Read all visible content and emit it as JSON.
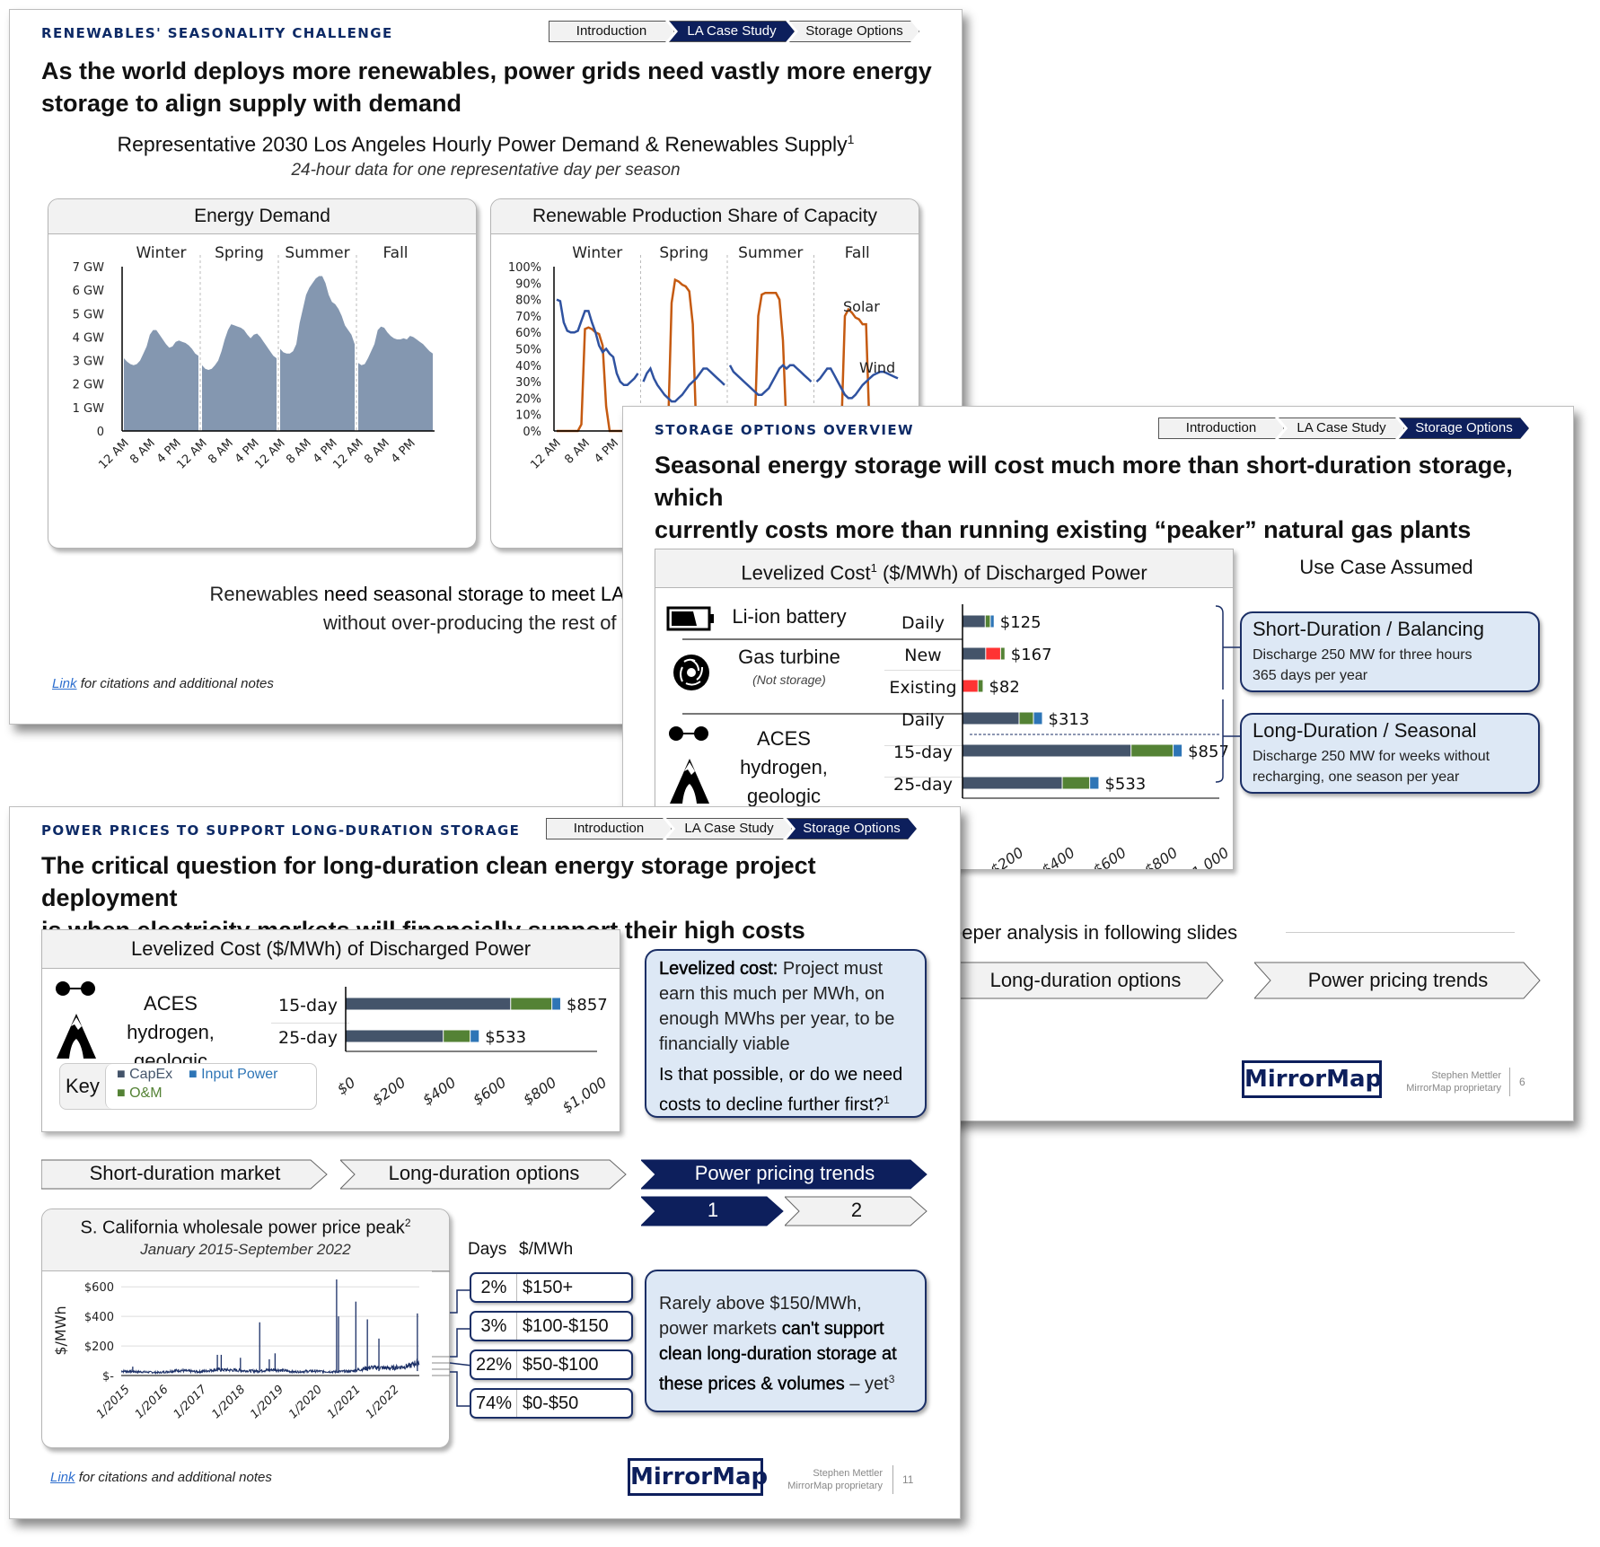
{
  "slide1": {
    "kicker": "RENEWABLES' SEASONALITY CHALLENGE",
    "breadcrumbs": [
      {
        "label": "Introduction",
        "active": false
      },
      {
        "label": "LA Case Study",
        "active": true
      },
      {
        "label": "Storage Options",
        "active": false
      }
    ],
    "headline_line1": "As the world deploys more renewables, power grids need vastly more energy",
    "headline_line2": "storage to align supply with demand",
    "chart_title": "Representative 2030 Los Angeles Hourly Power Demand & Renewables Supply",
    "chart_title_sup": "1",
    "chart_subtitle": "24-hour data for one representative day per season",
    "conclusion_line1_plain": "Renewables ",
    "conclusion_line1_bold": "need seasonal storage to meet LA's",
    "conclusion_line2": "without over-producing the rest of th",
    "footer_link": "Link",
    "footer_text": " for citations and additional notes"
  },
  "slide2": {
    "kicker": "STORAGE OPTIONS OVERVIEW",
    "breadcrumbs": [
      {
        "label": "Introduction",
        "active": false
      },
      {
        "label": "LA Case Study",
        "active": false
      },
      {
        "label": "Storage Options",
        "active": true
      }
    ],
    "headline_line1": "Seasonal energy storage will cost much more than short-duration storage, which",
    "headline_line2": "currently costs more than running existing “peaker” natural gas plants",
    "cost_box_title": "Levelized Cost",
    "cost_box_title_sup": "1",
    "cost_box_title_rest": " ($/MWh) of Discharged Power",
    "technologies": [
      {
        "name": "Li-ion battery",
        "sub": "",
        "icon": "battery-icon"
      },
      {
        "name": "Gas turbine",
        "sub": "(Not storage)",
        "icon": "turbine-icon"
      },
      {
        "name_line1": "ACES hydrogen,",
        "name_line2": "geologic storage",
        "icon": "hydrogen-geologic-icon"
      }
    ],
    "use_case_header": "Use Case Assumed",
    "use_cases": [
      {
        "title": "Short-Duration / Balancing",
        "line1": "Discharge 250 MW for three hours",
        "line2": "365 days per year"
      },
      {
        "title": "Long-Duration / Seasonal",
        "line1": "Discharge 250 MW for weeks without",
        "line2": "recharging, one season per year"
      }
    ],
    "deeper_label": "eeper analysis in following slides",
    "chevrons": [
      "Long-duration options",
      "Power pricing trends"
    ],
    "logo": "MirrorMap",
    "author": "Stephen Mettler",
    "proprietary": "MirrorMap proprietary",
    "page": "6"
  },
  "slide3": {
    "kicker": "POWER PRICES TO SUPPORT LONG-DURATION STORAGE",
    "breadcrumbs": [
      {
        "label": "Introduction",
        "active": false
      },
      {
        "label": "LA Case Study",
        "active": false
      },
      {
        "label": "Storage Options",
        "active": true
      }
    ],
    "headline_line1": "The critical question for long-duration clean energy storage project deployment",
    "headline_line2": "is when electricity markets will financially support their high costs",
    "cost_box_title": "Levelized Cost ($/MWh) of Discharged Power",
    "tech_line1": "ACES hydrogen,",
    "tech_line2": "geologic storage",
    "key_label": "Key",
    "key_items": [
      {
        "label": "CapEx",
        "color": "#44546a"
      },
      {
        "label": "Input Power",
        "color": "#2e75b6"
      },
      {
        "label": "O&M",
        "color": "#548235"
      }
    ],
    "callout_bold": "Levelized cost:",
    "callout_text": " Project must earn this much per MWh, on enough MWhs per year, to be financially viable",
    "callout_question": "Is that possible, or do we need costs to decline further first?",
    "callout_question_sup": "1",
    "chevrons": [
      {
        "label": "Short-duration market",
        "active": false
      },
      {
        "label": "Long-duration options",
        "active": false
      },
      {
        "label": "Power pricing trends",
        "active": true
      }
    ],
    "sub_chevrons": [
      {
        "label": "1",
        "active": true
      },
      {
        "label": "2",
        "active": false
      }
    ],
    "price_chart_title": "S. California wholesale power price peak",
    "price_chart_title_sup": "2",
    "price_chart_subtitle": "January 2015-September 2022",
    "days_header": "Days",
    "mwh_header": "$/MWh",
    "price_buckets": [
      {
        "pct": "2%",
        "range": "$150+"
      },
      {
        "pct": "3%",
        "range": "$100-$150"
      },
      {
        "pct": "22%",
        "range": "$50-$100"
      },
      {
        "pct": "74%",
        "range": "$0-$50"
      }
    ],
    "conclusion_plain1": "Rarely above $150/MWh, power markets ",
    "conclusion_bold": "can't support clean long-duration storage at these prices & volumes",
    "conclusion_plain2": " – yet",
    "conclusion_sup": "3",
    "footer_link": "Link",
    "footer_text": " for citations and additional notes",
    "logo": "MirrorMap",
    "author": "Stephen Mettler",
    "proprietary": "MirrorMap proprietary",
    "page": "11"
  },
  "colors": {
    "navy": "#0d1f5c",
    "capex": "#44546a",
    "om": "#548235",
    "input_power": "#2e75b6",
    "fuel": "#ff3333",
    "solar": "#c55a11",
    "wind": "#2f52a0",
    "demand_fill": "#8497b0"
  },
  "chart_data": [
    {
      "id": "energy-demand",
      "type": "area",
      "title": "Energy Demand",
      "seasons": [
        "Winter",
        "Spring",
        "Summer",
        "Fall"
      ],
      "ylabel": "",
      "yticks": [
        "0",
        "1 GW",
        "2 GW",
        "3 GW",
        "4 GW",
        "5 GW",
        "6 GW",
        "7 GW"
      ],
      "ylim": [
        0,
        7
      ],
      "xticks": [
        "12 AM",
        "8 AM",
        "4 PM",
        "12 AM",
        "8 AM",
        "4 PM",
        "12 AM",
        "8 AM",
        "4 PM",
        "12 AM",
        "8 AM",
        "4 PM"
      ],
      "series": [
        {
          "name": "Winter",
          "values": [
            3.1,
            2.95,
            2.85,
            2.8,
            2.85,
            3.0,
            3.3,
            3.6,
            4.1,
            4.3,
            4.3,
            4.1,
            3.9,
            3.7,
            3.55,
            3.6,
            3.8,
            3.85,
            3.8,
            3.75,
            3.65,
            3.5,
            3.3,
            3.2
          ]
        },
        {
          "name": "Spring",
          "values": [
            2.8,
            2.65,
            2.6,
            2.65,
            2.8,
            3.0,
            3.4,
            3.9,
            4.3,
            4.55,
            4.5,
            4.45,
            4.4,
            4.3,
            4.1,
            3.95,
            4.1,
            4.15,
            4.0,
            3.8,
            3.6,
            3.4,
            3.2,
            3.1
          ]
        },
        {
          "name": "Summer",
          "values": [
            3.5,
            3.35,
            3.3,
            3.3,
            3.4,
            3.7,
            4.6,
            5.2,
            5.8,
            6.1,
            6.3,
            6.5,
            6.6,
            6.6,
            6.3,
            5.8,
            5.5,
            5.4,
            5.2,
            4.9,
            4.5,
            4.3,
            4.1,
            3.7
          ]
        },
        {
          "name": "Fall",
          "values": [
            2.9,
            2.8,
            2.85,
            3.1,
            3.4,
            3.7,
            4.3,
            4.45,
            4.4,
            4.2,
            4.05,
            3.95,
            3.9,
            3.9,
            3.95,
            3.9,
            4.05,
            4.0,
            3.9,
            3.8,
            3.7,
            3.55,
            3.4,
            3.3
          ]
        }
      ]
    },
    {
      "id": "renewable-share",
      "type": "line",
      "title": "Renewable Production Share of Capacity",
      "seasons": [
        "Winter",
        "Spring",
        "Summer",
        "Fall"
      ],
      "yticks": [
        "0%",
        "10%",
        "20%",
        "30%",
        "40%",
        "50%",
        "60%",
        "70%",
        "80%",
        "90%",
        "100%"
      ],
      "ylim": [
        0,
        100
      ],
      "xticks": [
        "12 AM",
        "8 AM",
        "4 PM",
        "12"
      ],
      "series": [
        {
          "name": "Solar",
          "color": "#c55a11",
          "values": [
            [
              0,
              0,
              0,
              0,
              0,
              0,
              0,
              4,
              62,
              63,
              62,
              60,
              59,
              52,
              15,
              0,
              0,
              0,
              0,
              0,
              0,
              0,
              0,
              0
            ],
            [
              0,
              0,
              0,
              0,
              0,
              0,
              0,
              0,
              78,
              92,
              91,
              89,
              88,
              85,
              65,
              0,
              0,
              0,
              0,
              0,
              0,
              0,
              0,
              0
            ],
            [
              0,
              0,
              0,
              0,
              0,
              0,
              0,
              0,
              70,
              83,
              84,
              84,
              84,
              84,
              80,
              55,
              0,
              0,
              0,
              0,
              0,
              0,
              0,
              0
            ],
            [
              0,
              0,
              0,
              0,
              0,
              0,
              0,
              0,
              70,
              74,
              72,
              69,
              68,
              65,
              65,
              0,
              0,
              0,
              0,
              0,
              0,
              0,
              0,
              0
            ]
          ]
        },
        {
          "name": "Wind",
          "color": "#2f52a0",
          "values": [
            [
              80,
              79,
              66,
              61,
              60,
              60,
              61,
              67,
              73,
              73,
              66,
              60,
              52,
              48,
              50,
              47,
              45,
              35,
              30,
              28,
              28,
              30,
              32,
              35
            ],
            [
              30,
              35,
              38,
              32,
              28,
              25,
              22,
              20,
              18,
              18,
              20,
              22,
              25,
              28,
              30,
              32,
              35,
              38,
              38,
              36,
              34,
              32,
              30,
              28
            ],
            [
              40,
              36,
              34,
              32,
              30,
              28,
              26,
              24,
              22,
              22,
              24,
              26,
              30,
              34,
              38,
              40,
              38,
              40,
              40,
              38,
              36,
              34,
              32,
              30
            ],
            [
              30,
              32,
              35,
              38,
              38,
              34,
              30,
              26,
              22,
              20,
              20,
              22,
              25,
              28,
              30,
              32,
              34,
              35,
              36,
              36,
              35,
              34,
              33,
              32
            ]
          ]
        }
      ],
      "annotations": [
        "Solar",
        "Wind"
      ]
    },
    {
      "id": "levelized-cost-overview",
      "type": "bar",
      "stacked": true,
      "title": "Levelized Cost ($/MWh) of Discharged Power",
      "categories": [
        "Li-ion battery Daily",
        "Gas turbine New",
        "Gas turbine Existing",
        "ACES hydrogen Daily",
        "ACES hydrogen 15-day",
        "ACES hydrogen 25-day"
      ],
      "row_labels": [
        "Daily",
        "New",
        "Existing",
        "Daily",
        "15-day",
        "25-day"
      ],
      "series": [
        {
          "name": "CapEx",
          "color": "#44546a",
          "values": [
            90,
            92,
            0,
            222,
            658,
            390
          ]
        },
        {
          "name": "Fuel",
          "color": "#ff3333",
          "values": [
            0,
            58,
            62,
            0,
            0,
            0
          ]
        },
        {
          "name": "O&M",
          "color": "#548235",
          "values": [
            20,
            17,
            20,
            56,
            164,
            107
          ]
        },
        {
          "name": "Input Power",
          "color": "#2e75b6",
          "values": [
            15,
            0,
            0,
            35,
            35,
            36
          ]
        }
      ],
      "totals": [
        "$125",
        "$167",
        "$82",
        "$313",
        "$857",
        "$533"
      ],
      "xticks": [
        "$200",
        "$400",
        "$600",
        "$800",
        "$1,000"
      ],
      "xlim": [
        0,
        1000
      ]
    },
    {
      "id": "levelized-cost-aces",
      "type": "bar",
      "stacked": true,
      "title": "Levelized Cost ($/MWh) of Discharged Power",
      "categories": [
        "15-day",
        "25-day"
      ],
      "series": [
        {
          "name": "CapEx",
          "color": "#44546a",
          "values": [
            658,
            390
          ]
        },
        {
          "name": "O&M",
          "color": "#548235",
          "values": [
            164,
            107
          ]
        },
        {
          "name": "Input Power",
          "color": "#2e75b6",
          "values": [
            35,
            36
          ]
        }
      ],
      "totals": [
        "$857",
        "$533"
      ],
      "xticks": [
        "$0",
        "$200",
        "$400",
        "$600",
        "$800",
        "$1,000"
      ],
      "xlim": [
        0,
        1000
      ]
    },
    {
      "id": "socal-price",
      "type": "line",
      "title": "S. California wholesale power price peak",
      "subtitle": "January 2015-September 2022",
      "ylabel": "$/MWh",
      "yticks": [
        "$-",
        "$200",
        "$400",
        "$600"
      ],
      "ylim": [
        0,
        650
      ],
      "xticks": [
        "1/2015",
        "1/2016",
        "1/2017",
        "1/2018",
        "1/2019",
        "1/2020",
        "1/2021",
        "1/2022"
      ],
      "spikes": [
        {
          "year": 2015.3,
          "value": 60
        },
        {
          "year": 2017.5,
          "value": 140
        },
        {
          "year": 2017.6,
          "value": 140
        },
        {
          "year": 2018.1,
          "value": 120
        },
        {
          "year": 2018.6,
          "value": 360
        },
        {
          "year": 2018.85,
          "value": 110
        },
        {
          "year": 2019.0,
          "value": 150
        },
        {
          "year": 2020.6,
          "value": 650
        },
        {
          "year": 2020.65,
          "value": 400
        },
        {
          "year": 2021.1,
          "value": 500
        },
        {
          "year": 2021.4,
          "value": 380
        },
        {
          "year": 2021.7,
          "value": 250
        },
        {
          "year": 2022.7,
          "value": 420
        }
      ],
      "baseline": [
        [
          2015.0,
          30
        ],
        [
          2015.5,
          25
        ],
        [
          2016.0,
          20
        ],
        [
          2016.5,
          35
        ],
        [
          2017.0,
          25
        ],
        [
          2017.5,
          40
        ],
        [
          2018.0,
          35
        ],
        [
          2018.5,
          30
        ],
        [
          2019.0,
          40
        ],
        [
          2019.5,
          25
        ],
        [
          2020.0,
          30
        ],
        [
          2020.5,
          25
        ],
        [
          2021.0,
          30
        ],
        [
          2021.5,
          55
        ],
        [
          2022.0,
          50
        ],
        [
          2022.5,
          65
        ],
        [
          2022.7,
          90
        ]
      ]
    }
  ]
}
